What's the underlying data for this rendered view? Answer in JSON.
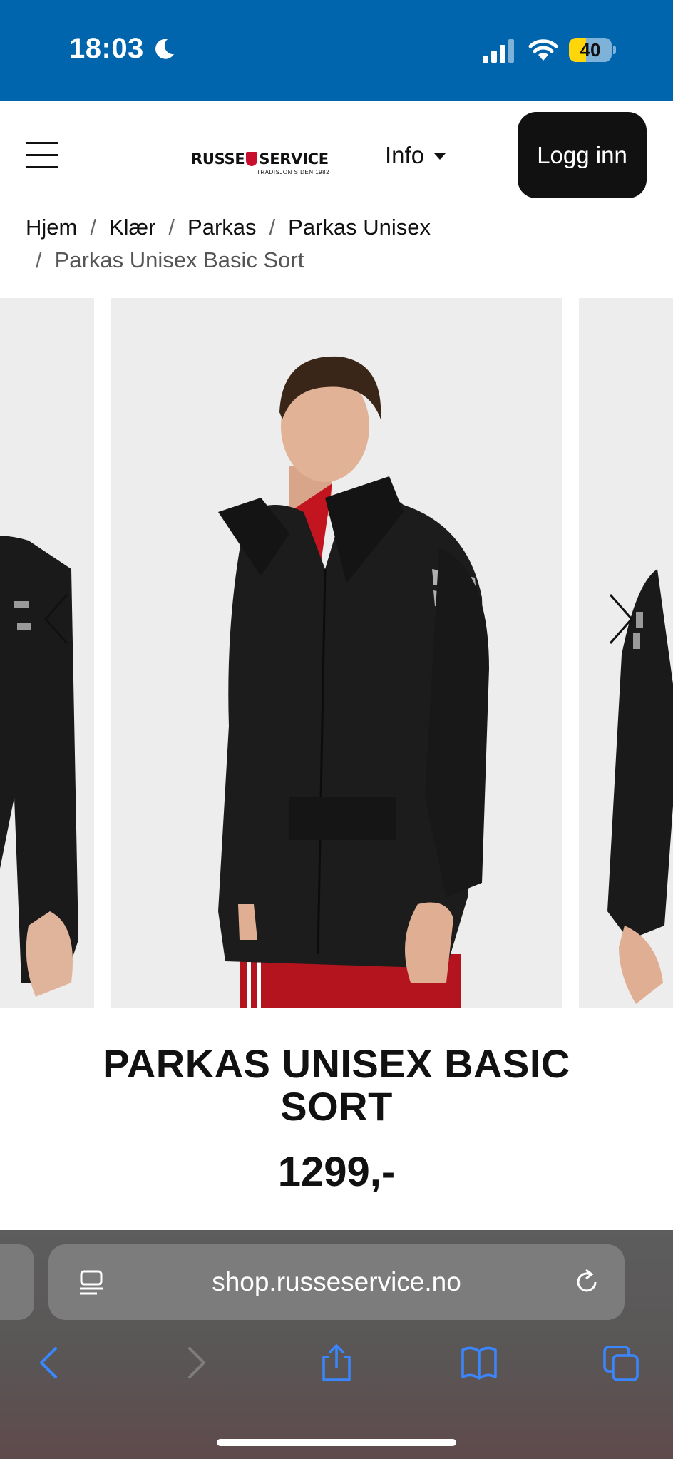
{
  "status_bar": {
    "time": "18:03",
    "battery": "40",
    "battery_level": 0.4,
    "icons": [
      "moon-icon",
      "signal-icon",
      "wifi-icon",
      "battery-icon"
    ]
  },
  "header": {
    "logo_text": "RUSSE",
    "logo_text2": "SERVICE",
    "logo_tagline": "TRADISJON SIDEN 1982",
    "info_label": "Info",
    "login_label": "Logg inn"
  },
  "breadcrumb": {
    "items": [
      "Hjem",
      "Klær",
      "Parkas",
      "Parkas Unisex"
    ],
    "current": "Parkas Unisex Basic Sort",
    "separator": "/"
  },
  "product": {
    "title": "PARKAS UNISEX BASIC SORT",
    "price": "1299,-"
  },
  "browser": {
    "url": "shop.russeservice.no"
  },
  "colors": {
    "status_bar": "#0165ae",
    "button": "#111111",
    "product_bg": "#ededed",
    "jacket": "#1a1a1a",
    "pants": "#b3141e"
  }
}
